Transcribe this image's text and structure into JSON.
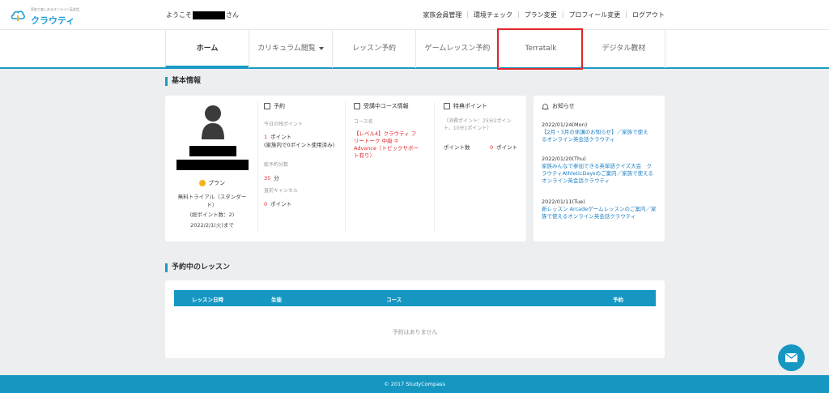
{
  "header": {
    "logo_tagline": "家族で楽しめるオンライン英会話",
    "logo_text": "クラウティ",
    "welcome_prefix": "ようこそ",
    "welcome_suffix": "さん",
    "nav": [
      "家族会員管理",
      "環境チェック",
      "プラン変更",
      "プロフィール変更",
      "ログアウト"
    ]
  },
  "tabs": [
    {
      "label": "ホーム",
      "active": true
    },
    {
      "label": "カリキュラム閲覧",
      "dropdown": true
    },
    {
      "label": "レッスン予約"
    },
    {
      "label": "ゲームレッスン予約"
    },
    {
      "label": "Terratalk",
      "highlighted": true
    },
    {
      "label": "デジタル教材"
    }
  ],
  "basic_info": {
    "title": "基本情報",
    "profile": {
      "plan_label": "プラン",
      "plan_name": "無料トライアル（スタンダード）",
      "plan_name_line1": "無料トライアル（スタンダー",
      "plan_name_line2": "ド）",
      "total_points": "(総ポイント数：2)",
      "expiry": "2022/2/1(火)まで"
    },
    "reservation": {
      "title": "予約",
      "today_label": "今日の残ポイント",
      "today_value": "1",
      "today_unit": "ポイント",
      "today_note": "(家族内で0ポイント使用済み)",
      "total_minutes_label": "総予約分数",
      "total_minutes_value": "35",
      "total_minutes_unit": "分",
      "cancel_label": "直前キャンセル",
      "cancel_value": "0",
      "cancel_unit": "ポイント"
    },
    "course": {
      "title": "受講中コース情報",
      "name_label": "コース名",
      "name_lines": [
        "【レベル4】クラウティ フ",
        "リートーク 中級 ②",
        "Advance（トピックサポー",
        "ト有り）"
      ]
    },
    "bonus": {
      "title": "特典ポイント",
      "note_lines": [
        "（消費ポイント：25分2ポイン",
        "ト、10分1ポイント）"
      ],
      "points_label": "ポイント数",
      "points_value": "0",
      "points_unit": "ポイント"
    },
    "news": {
      "title": "お知らせ",
      "items": [
        {
          "date": "2022/01/24(Mon)",
          "lines": [
            "【2月・3月の休講のお知らせ】／家族で使え",
            "るオンライン英会話クラウティ"
          ]
        },
        {
          "date": "2022/01/20(Thu)",
          "lines": [
            "家族みんなで参加できる英単語クイズ大会　ク",
            "ラウティAthleticDaysのご案内／家族で使える",
            "オンライン英会話クラウティ"
          ]
        },
        {
          "date": "2022/01/11(Tue)",
          "lines": [
            "新レッスン Arcadeゲームレッスンのご案内／家",
            "族で使えるオンライン英会話クラウティ"
          ]
        }
      ]
    }
  },
  "reservations": {
    "title": "予約中のレッスン",
    "columns": [
      "レッスン日時",
      "生徒",
      "コース",
      "予約"
    ],
    "empty_text": "予約はありません"
  },
  "footer": {
    "copyright": "© 2017 StudyCompass"
  },
  "colors": {
    "accent": "#1597c2",
    "highlight": "#e0262c",
    "link": "#1b7fc4"
  }
}
